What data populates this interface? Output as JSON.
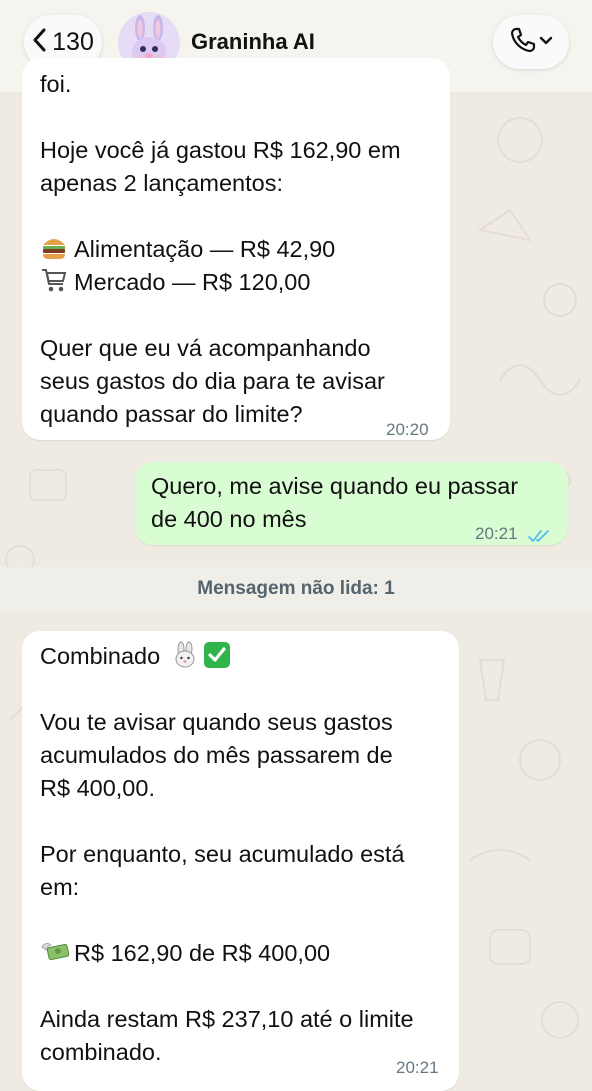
{
  "header": {
    "back_count": "130",
    "contact_name": "Graninha AI"
  },
  "messages": {
    "m1": {
      "clipped_top": "foi.",
      "line1": "Hoje você já gastou R$ 162,90 em",
      "line2": "apenas 2 lançamentos:",
      "item1": "Alimentação — R$ 42,90",
      "item2": "Mercado — R$ 120,00",
      "line3": "Quer que eu vá acompanhando",
      "line4": "seus gastos do dia para te avisar",
      "line5": "quando passar do limite?",
      "time": "20:20"
    },
    "m2": {
      "line1": "Quero, me avise quando eu passar",
      "line2": "de 400 no mês",
      "time": "20:21"
    },
    "unread_divider": "Mensagem não lida: 1",
    "m3": {
      "line1": "Combinado",
      "line2": "Vou te avisar quando seus gastos",
      "line3": "acumulados do mês passarem de",
      "line4": "R$ 400,00.",
      "line5": "Por enquanto, seu acumulado está",
      "line6": "em:",
      "line7": "R$ 162,90 de R$ 400,00",
      "line8": "Ainda restam R$ 237,10 até o limite",
      "line9": "combinado.",
      "time": "20:21"
    }
  },
  "colors": {
    "background": "#efeae2",
    "incoming_bubble": "#ffffff",
    "outgoing_bubble": "#d9fdd3",
    "read_ticks": "#53bdeb",
    "timestamp": "#667781"
  },
  "icons": [
    "chevron-left-icon",
    "bunny-avatar",
    "phone-icon",
    "chevron-down-icon",
    "burger-emoji",
    "cart-emoji",
    "rabbit-emoji",
    "check-mark-emoji",
    "money-with-wings-emoji",
    "double-check-icon"
  ]
}
